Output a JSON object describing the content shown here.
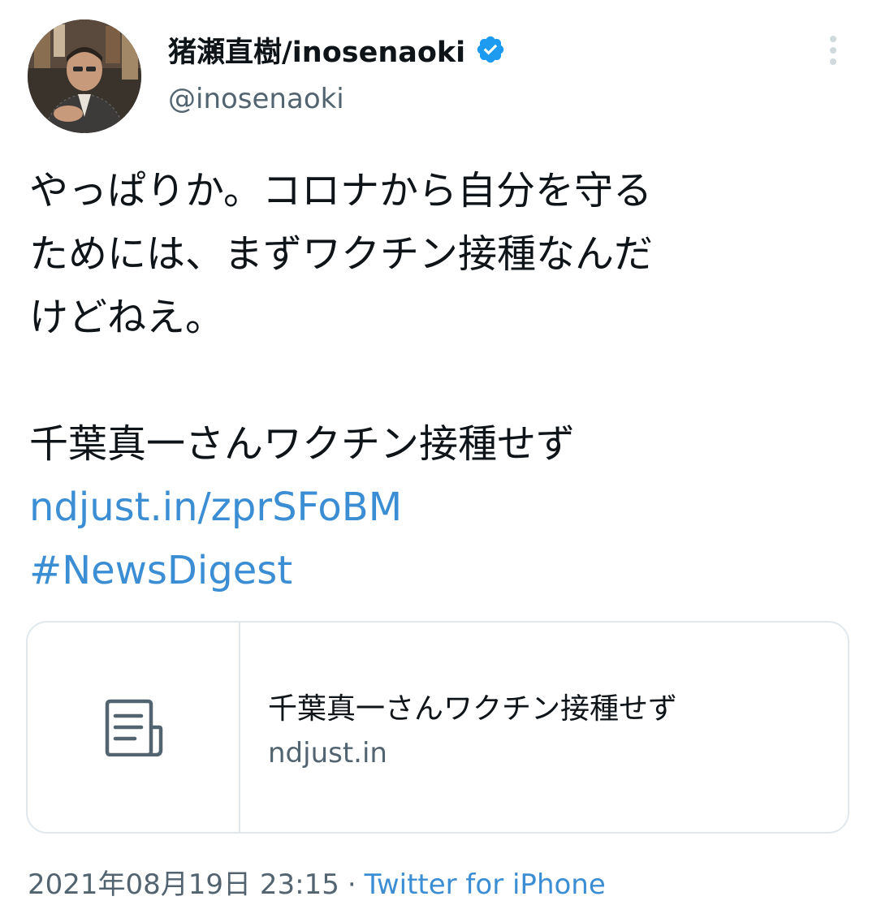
{
  "tweet": {
    "display_name": "猪瀬直樹/inosenaoki",
    "handle": "@inosenaoki",
    "verified_icon": "verified-badge-icon",
    "more_icon": "more-vertical-icon",
    "text_lines": [
      "やっぱりか。コロナから自分を守る",
      "ためには、まずワクチン接種なんだ",
      "けどねえ。",
      "千葉真一さんワクチン接種せず"
    ],
    "link_text": "ndjust.in/zprSFoBM",
    "hashtag": "#NewsDigest"
  },
  "card": {
    "icon": "article-document-icon",
    "title": "千葉真一さんワクチン接種せず",
    "domain": "ndjust.in"
  },
  "meta": {
    "timestamp": "2021年08月19日 23:15",
    "separator": "·",
    "source": "Twitter for iPhone"
  },
  "colors": {
    "link": "#3b8ed4",
    "verified": "#1d9bf0",
    "secondary_text": "#536471",
    "border": "#e1e8ed"
  }
}
